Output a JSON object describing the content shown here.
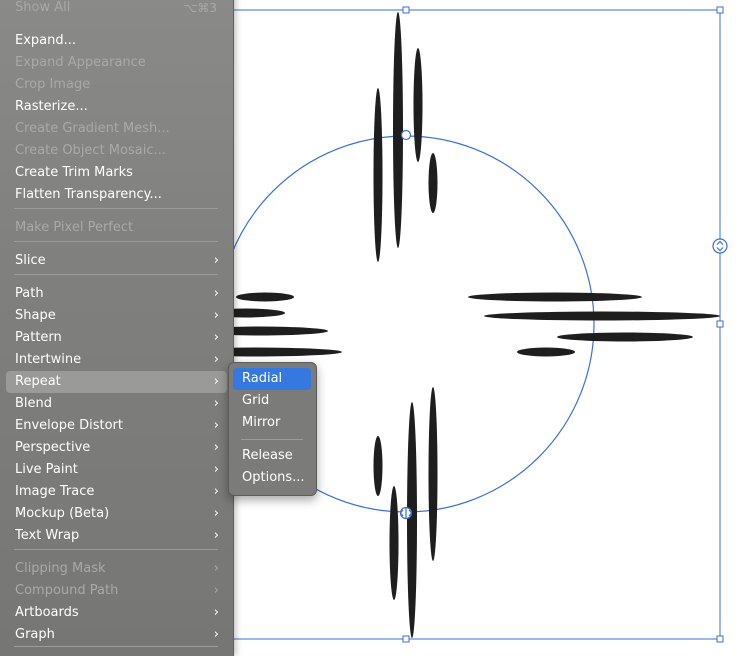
{
  "menu": {
    "items": [
      {
        "label": "Show All",
        "shortcut": "⌥⌘3",
        "disabled": true,
        "submenu": false
      },
      {
        "label": "Expand...",
        "disabled": false,
        "submenu": false
      },
      {
        "label": "Expand Appearance",
        "disabled": true,
        "submenu": false
      },
      {
        "label": "Crop Image",
        "disabled": true,
        "submenu": false
      },
      {
        "label": "Rasterize...",
        "disabled": false,
        "submenu": false
      },
      {
        "label": "Create Gradient Mesh...",
        "disabled": true,
        "submenu": false
      },
      {
        "label": "Create Object Mosaic...",
        "disabled": true,
        "submenu": false
      },
      {
        "label": "Create Trim Marks",
        "disabled": false,
        "submenu": false
      },
      {
        "label": "Flatten Transparency...",
        "disabled": false,
        "submenu": false
      },
      {
        "label": "Make Pixel Perfect",
        "disabled": true,
        "submenu": false
      },
      {
        "label": "Slice",
        "disabled": false,
        "submenu": true
      },
      {
        "label": "Path",
        "disabled": false,
        "submenu": true
      },
      {
        "label": "Shape",
        "disabled": false,
        "submenu": true
      },
      {
        "label": "Pattern",
        "disabled": false,
        "submenu": true
      },
      {
        "label": "Intertwine",
        "disabled": false,
        "submenu": true
      },
      {
        "label": "Repeat",
        "disabled": false,
        "submenu": true,
        "highlighted": true
      },
      {
        "label": "Blend",
        "disabled": false,
        "submenu": true
      },
      {
        "label": "Envelope Distort",
        "disabled": false,
        "submenu": true
      },
      {
        "label": "Perspective",
        "disabled": false,
        "submenu": true
      },
      {
        "label": "Live Paint",
        "disabled": false,
        "submenu": true
      },
      {
        "label": "Image Trace",
        "disabled": false,
        "submenu": true
      },
      {
        "label": "Mockup (Beta)",
        "disabled": false,
        "submenu": true
      },
      {
        "label": "Text Wrap",
        "disabled": false,
        "submenu": true
      },
      {
        "label": "Clipping Mask",
        "disabled": true,
        "submenu": true
      },
      {
        "label": "Compound Path",
        "disabled": true,
        "submenu": true
      },
      {
        "label": "Artboards",
        "disabled": false,
        "submenu": true
      },
      {
        "label": "Graph",
        "disabled": false,
        "submenu": true
      }
    ]
  },
  "submenu": {
    "items": [
      {
        "label": "Radial",
        "active": true
      },
      {
        "label": "Grid",
        "active": false
      },
      {
        "label": "Mirror",
        "active": false
      },
      {
        "label": "Release",
        "active": false
      },
      {
        "label": "Options...",
        "active": false
      }
    ]
  },
  "icons": {
    "submenu_arrow": "chevron-right-icon",
    "chevron_glyph": "›",
    "resize_handle": "updown-handle-icon"
  },
  "colors": {
    "selection": "#3a6fd8",
    "shape_fill": "#1e1e1e",
    "highlight": "#3478e0",
    "menu_bg": "#808080"
  }
}
